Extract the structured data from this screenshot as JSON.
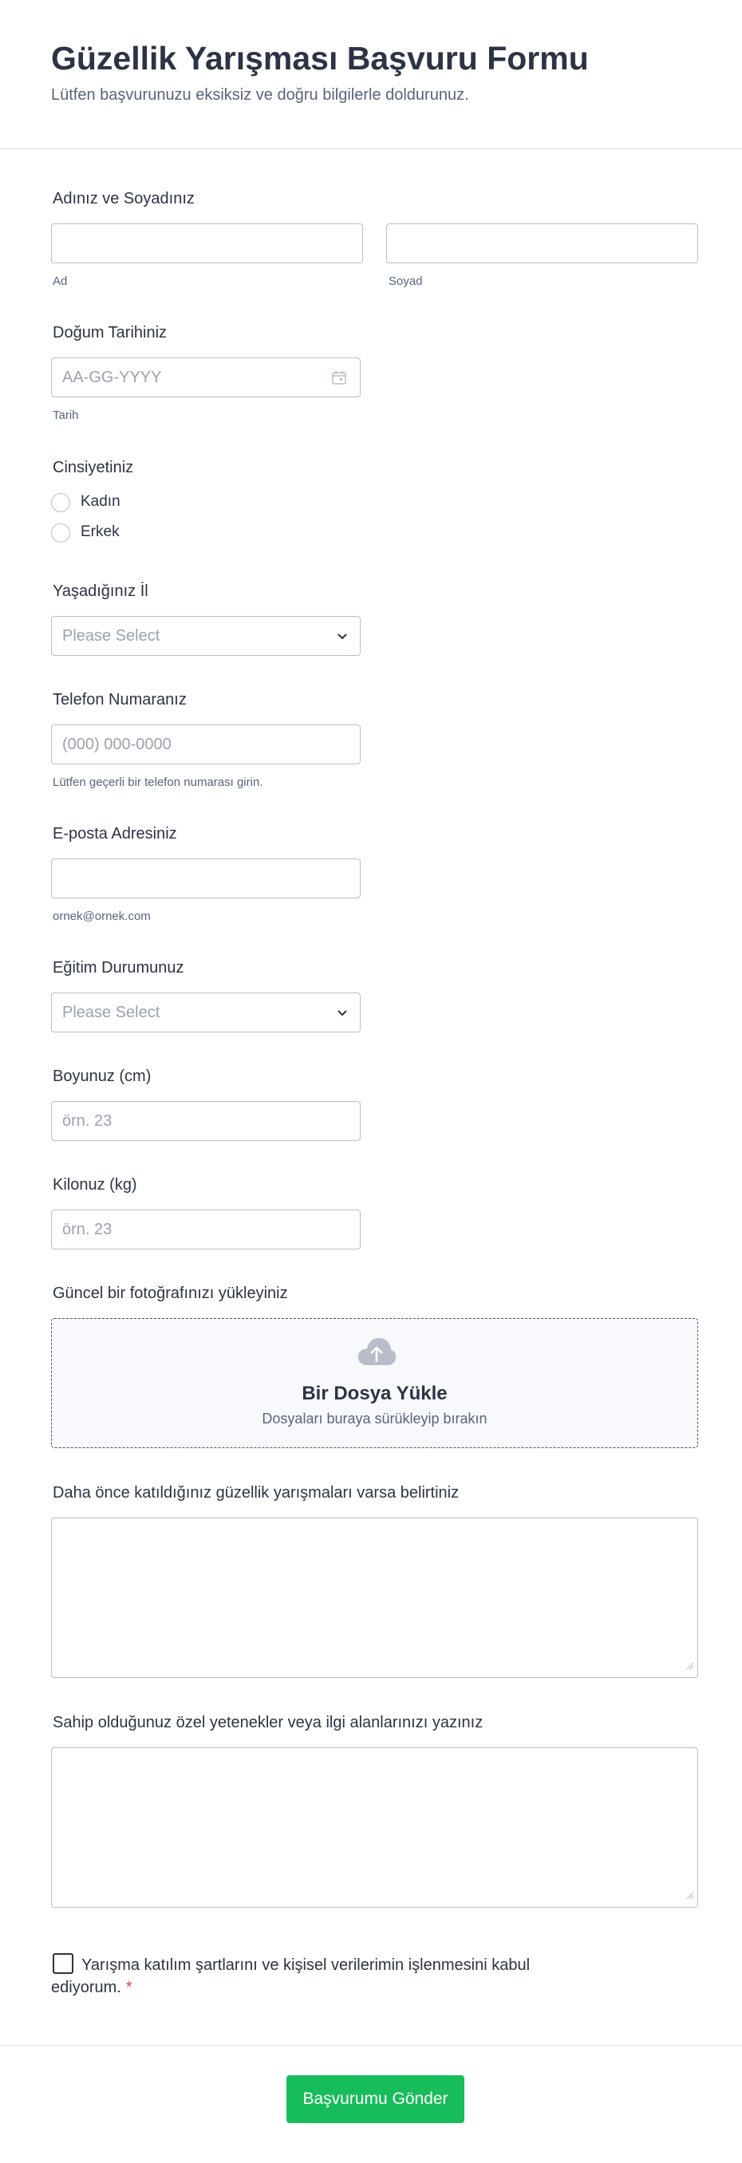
{
  "header": {
    "title": "Güzellik Yarışması Başvuru Formu",
    "subtitle": "Lütfen başvurunuzu eksiksiz ve doğru bilgilerle doldurunuz."
  },
  "name": {
    "label": "Adınız ve Soyadınız",
    "first_sublabel": "Ad",
    "last_sublabel": "Soyad",
    "first_value": "",
    "last_value": ""
  },
  "birth": {
    "label": "Doğum Tarihiniz",
    "placeholder": "AA-GG-YYYY",
    "sublabel": "Tarih",
    "icon": "calendar-icon"
  },
  "gender": {
    "label": "Cinsiyetiniz",
    "options": [
      "Kadın",
      "Erkek"
    ]
  },
  "city": {
    "label": "Yaşadığınız İl",
    "placeholder": "Please Select",
    "icon": "chevron-down-icon"
  },
  "phone": {
    "label": "Telefon Numaranız",
    "placeholder": "(000) 000-0000",
    "sublabel": "Lütfen geçerli bir telefon numarası girin."
  },
  "email": {
    "label": "E-posta Adresiniz",
    "value": "",
    "sublabel": "ornek@ornek.com"
  },
  "education": {
    "label": "Eğitim Durumunuz",
    "placeholder": "Please Select",
    "icon": "chevron-down-icon"
  },
  "height": {
    "label": "Boyunuz (cm)",
    "placeholder": "örn. 23"
  },
  "weight": {
    "label": "Kilonuz (kg)",
    "placeholder": "örn. 23"
  },
  "photo": {
    "label": "Güncel bir fotoğrafınızı yükleyiniz",
    "upload_title": "Bir Dosya Yükle",
    "upload_sub": "Dosyaları buraya sürükleyip bırakın",
    "icon": "cloud-upload-icon"
  },
  "contests": {
    "label": "Daha önce katıldığınız güzellik yarışmaları varsa belirtiniz",
    "value": ""
  },
  "talents": {
    "label": "Sahip olduğunuz özel yetenekler veya ilgi alanlarınızı yazınız",
    "value": ""
  },
  "consent": {
    "text": "Yarışma katılım şartlarını ve kişisel verilerimin işlenmesini kabul ediyorum.",
    "required_mark": "*"
  },
  "submit": {
    "label": "Başvurumu Gönder",
    "color": "#18bd5b"
  },
  "colors": {
    "text": "#2c3345",
    "muted": "#57647e",
    "border": "#b8bdc9",
    "required": "#f23a3c"
  }
}
